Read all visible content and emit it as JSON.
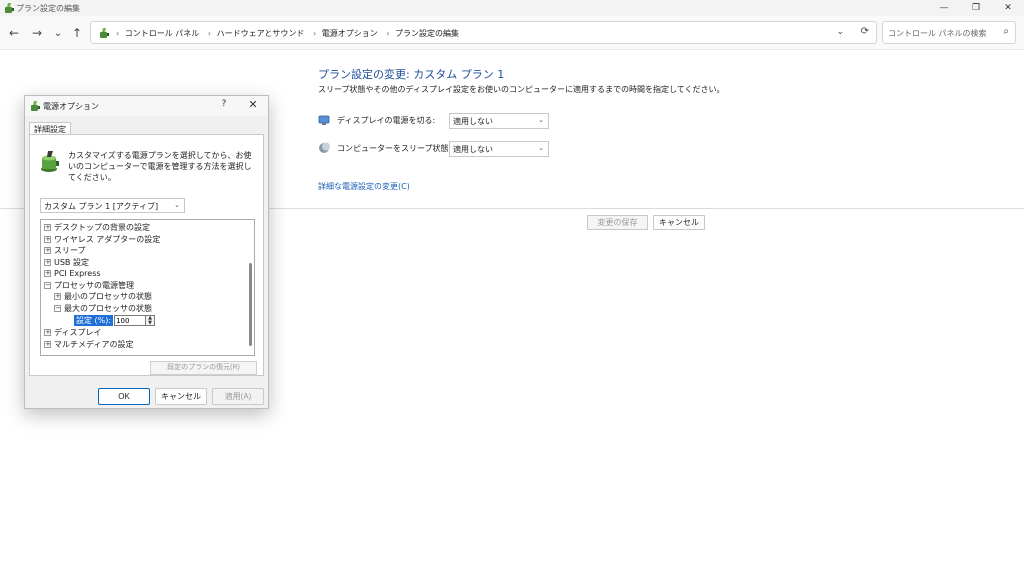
{
  "window": {
    "title": "プラン設定の編集",
    "controls": {
      "minimize": "—",
      "restore": "❐",
      "close": "✕"
    }
  },
  "nav": {
    "back": "←",
    "forward": "→",
    "history": "⌄",
    "up": "↑"
  },
  "address": {
    "crumbs": [
      "コントロール パネル",
      "ハードウェアとサウンド",
      "電源オプション",
      "プラン設定の編集"
    ],
    "separator": "›",
    "leading_separator": "›",
    "dropdown": "⌄",
    "refresh": "⟳"
  },
  "search": {
    "placeholder": "コントロール パネルの検索",
    "icon": "⌕"
  },
  "content": {
    "title": "プラン設定の変更: カスタム プラン 1",
    "description": "スリープ状態やその他のディスプレイ設定をお使いのコンピューターに適用するまでの時間を指定してください。",
    "display_label": "ディスプレイの電源を切る:",
    "display_value": "適用しない",
    "sleep_label": "コンピューターをスリープ状態にする:",
    "sleep_value": "適用しない",
    "advanced_link": "詳細な電源設定の変更(C)",
    "save_label": "変更の保存",
    "cancel_label": "キャンセル",
    "chevron": "⌄"
  },
  "dialog": {
    "title": "電源オプション",
    "help": "?",
    "close": "✕",
    "tab": "詳細設定",
    "intro": "カスタマイズする電源プランを選択してから、お使いのコンピューターで電源を管理する方法を選択してください。",
    "plan": "カスタム プラン 1 [アクティブ]",
    "tree": [
      {
        "label": "デスクトップの背景の設定",
        "toggle": "+"
      },
      {
        "label": "ワイヤレス アダプターの設定",
        "toggle": "+"
      },
      {
        "label": "スリープ",
        "toggle": "+"
      },
      {
        "label": "USB 設定",
        "toggle": "+"
      },
      {
        "label": "PCI Express",
        "toggle": "+"
      },
      {
        "label": "プロセッサの電源管理",
        "toggle": "−"
      },
      {
        "label": "最小のプロセッサの状態",
        "toggle": "+"
      },
      {
        "label": "最大のプロセッサの状態",
        "toggle": "−"
      },
      {
        "label": "ディスプレイ",
        "toggle": "+"
      },
      {
        "label": "マルチメディアの設定",
        "toggle": "+"
      }
    ],
    "setting_label": "設定 (%):",
    "setting_value": "100",
    "spin_up": "▲",
    "spin_down": "▼",
    "restore_label": "既定のプランの復元(R)",
    "ok_label": "OK",
    "cancel_label": "キャンセル",
    "apply_label": "適用(A)"
  }
}
